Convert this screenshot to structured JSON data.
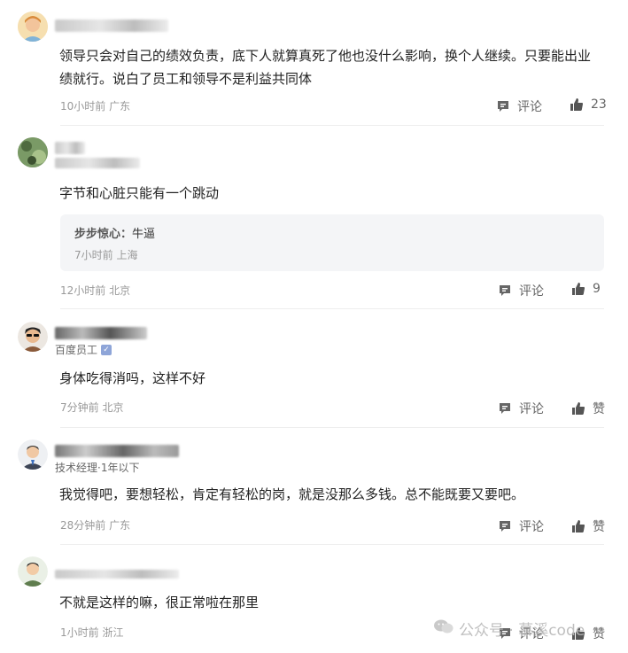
{
  "comments": [
    {
      "text": "领导只会对自己的绩效负责，底下人就算真死了他也没什么影响，换个人继续。只要能出业绩就行。说白了员工和领导不是利益共同体",
      "time": "10小时前",
      "location": "广东",
      "reply_label": "评论",
      "likes": "23"
    },
    {
      "text": "字节和心脏只能有一个跳动",
      "time": "12小时前",
      "location": "北京",
      "reply_label": "评论",
      "likes": "9",
      "reply": {
        "author": "步步惊心：",
        "content": "牛逼",
        "time": "7小时前",
        "location": "上海"
      }
    },
    {
      "subtitle": "百度员工",
      "text": "身体吃得消吗，这样不好",
      "time": "7分钟前",
      "location": "北京",
      "reply_label": "评论",
      "likes": "赞"
    },
    {
      "subtitle": "技术经理·1年以下",
      "text": "我觉得吧，要想轻松，肯定有轻松的岗，就是没那么多钱。总不能既要又要吧。",
      "time": "28分钟前",
      "location": "广东",
      "reply_label": "评论",
      "likes": "赞"
    },
    {
      "text": "不就是这样的嘛，很正常啦在那里",
      "time": "1小时前",
      "location": "浙江",
      "reply_label": "评论",
      "likes": "赞"
    }
  ],
  "watermark": "公众号 · 慕溪code",
  "icons": {
    "comment": "comment-icon",
    "like": "thumbs-up-icon",
    "verified": "verified-badge-icon"
  }
}
